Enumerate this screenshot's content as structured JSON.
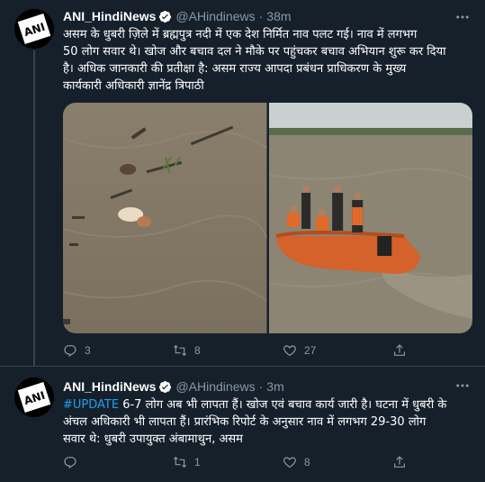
{
  "tweets": [
    {
      "name": "ANI_HindiNews",
      "handle": "@AHindinews",
      "time": "38m",
      "avatar_text": "ANI",
      "lines": [
        "असम के धुबरी ज़िले में ब्रह्मपुत्र नदी में एक देश निर्मित नाव पलट गई। नाव में लगभग",
        "50 लोग सवार थे। खोज और बचाव दल ने मौके पर पहुंचकर बचाव अभियान शुरू कर दिया",
        "है। अधिक जानकारी की प्रतीक्षा है: असम राज्य आपदा प्रबंधन प्राधिकरण के मुख्य",
        "कार्यकारी अधिकारी ज्ञानेंद्र त्रिपाठी"
      ],
      "replies": "3",
      "retweets": "8",
      "likes": "27"
    },
    {
      "name": "ANI_HindiNews",
      "handle": "@AHindinews",
      "time": "3m",
      "avatar_text": "ANI",
      "hashtag": "#UPDATE",
      "first_line_rest": " 6-7 लोग अब भी लापता हैं। खोज एवं बचाव कार्य जारी है। घटना में धुबरी के",
      "lines": [
        "अंचल अधिकारी भी लापता हैं। प्रारंभिक रिपोर्ट के अनुसार नाव में लगभग 29-30 लोग",
        "सवार थे: धुबरी उपायुक्त अंबामाथुन, असम"
      ],
      "replies": "",
      "retweets": "1",
      "likes": "8"
    }
  ],
  "icons": {
    "reply": "reply-icon",
    "retweet": "retweet-icon",
    "like": "heart-icon",
    "share": "share-icon",
    "more": "more-icon",
    "verified": "verified-badge-icon"
  },
  "colors": {
    "background": "#15202b",
    "muted": "#8899a6",
    "accent": "#1da1f2",
    "divider": "#38444d"
  }
}
